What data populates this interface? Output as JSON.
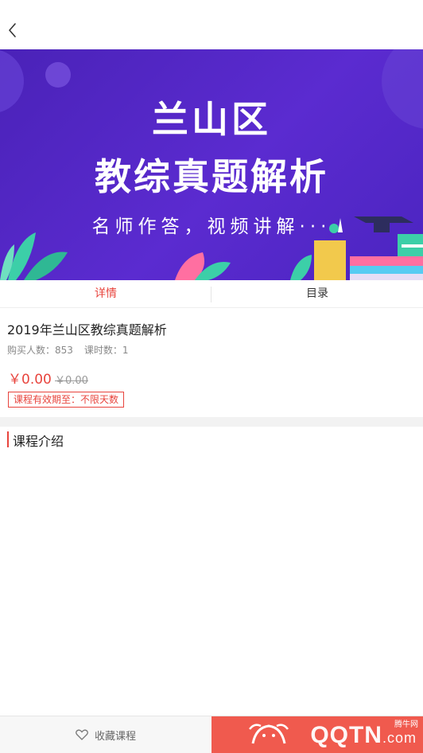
{
  "banner": {
    "line1": "兰山区",
    "line2": "教综真题解析",
    "line3": "名师作答，视频讲解···"
  },
  "tabs": [
    {
      "label": "详情",
      "active": true
    },
    {
      "label": "目录",
      "active": false
    }
  ],
  "course": {
    "title": "2019年兰山区教综真题解析",
    "buyers": "购买人数：853",
    "lessons": "课时数：1",
    "price": "￥0.00",
    "original_price": "￥0.00",
    "validity": "课程有效期至：不限天数"
  },
  "section": {
    "title": "课程介绍"
  },
  "bottom": {
    "favorite_label": "收藏课程",
    "watermark": "QQTN",
    "watermark_suffix": ".com",
    "watermark_cn": "腾牛网"
  },
  "colors": {
    "accent": "#e8443d",
    "banner_bg": "#5b2bd0",
    "buy_bg": "#f05a4e"
  }
}
